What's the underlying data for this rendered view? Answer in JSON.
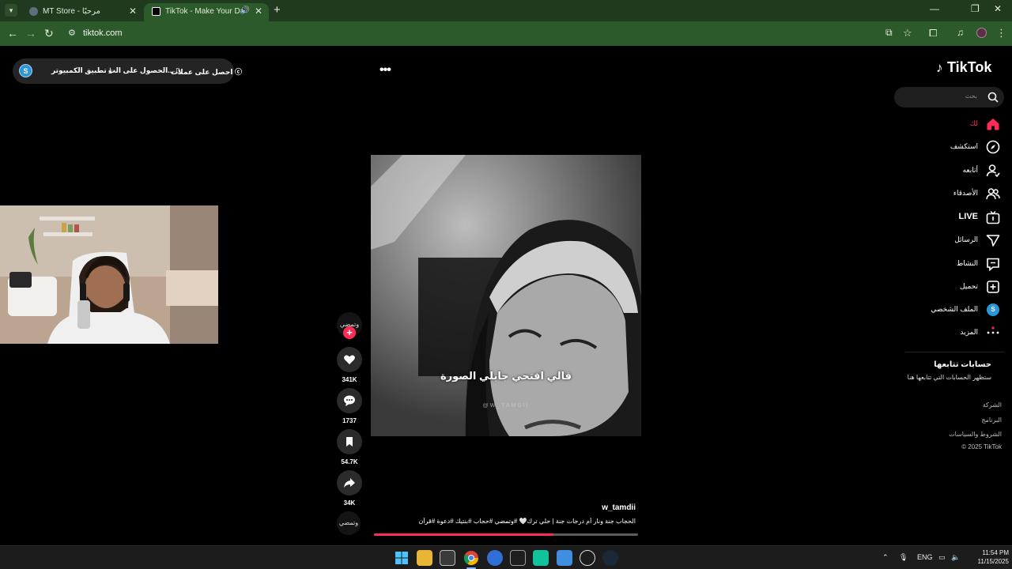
{
  "browser": {
    "tabs": [
      {
        "title": "MT Store - مرحبًا",
        "active": false
      },
      {
        "title": "TikTok - Make Your Day",
        "active": true
      }
    ],
    "url": "tiktok.com"
  },
  "promo_bar": {
    "avatar_letter": "S",
    "items": [
      "احصل على عملات",
      "الحصول على الت...",
      "تطبيق الكمبيوتر"
    ]
  },
  "video": {
    "caption_overlay": "قالي افتحي جابلي الصورة",
    "watermark": "@W_TAMDII",
    "username": "w_tamdii",
    "description": "الحجاب جنة ونار أم درجات جنة | حلي ترك🤍 #وتمضي #حجاب #بنتيك #دعوة #قرآن",
    "progress": 0.68
  },
  "actions": {
    "creator_label": "وتمضي",
    "likes": "341K",
    "comments": "1737",
    "saves": "54.7K",
    "shares": "34K",
    "music_label": "وتمضي"
  },
  "sidebar": {
    "logo": "TikTok",
    "search_placeholder": "بحث",
    "nav": [
      {
        "label": "لك",
        "icon": "home-icon",
        "active": true
      },
      {
        "label": "استكشف",
        "icon": "compass-icon"
      },
      {
        "label": "أتابعه",
        "icon": "following-icon"
      },
      {
        "label": "الأصدقاء",
        "icon": "friends-icon"
      },
      {
        "label": "LIVE",
        "icon": "live-icon"
      },
      {
        "label": "الرسائل",
        "icon": "messages-icon"
      },
      {
        "label": "النشاط",
        "icon": "activity-icon"
      },
      {
        "label": "تحميل",
        "icon": "upload-icon"
      },
      {
        "label": "الملف الشخصي",
        "icon": "profile-avatar"
      },
      {
        "label": "المزيد",
        "icon": "more-icon"
      }
    ],
    "avatar_letter": "S",
    "following_heading": "حسابات تتابعها",
    "following_subtext": "ستظهر الحسابات التي تتابعها هنا",
    "footer": [
      "الشركة",
      "البرنامج",
      "الشروط والسياسات",
      "© 2025 TikTok"
    ]
  },
  "taskbar": {
    "language": "ENG",
    "time": "11:54 PM",
    "date": "11/15/2025"
  },
  "colors": {
    "accent": "#fe2c55",
    "chrome_frame": "#1f3a1f",
    "chrome_toolbar": "#2d5a2a"
  }
}
